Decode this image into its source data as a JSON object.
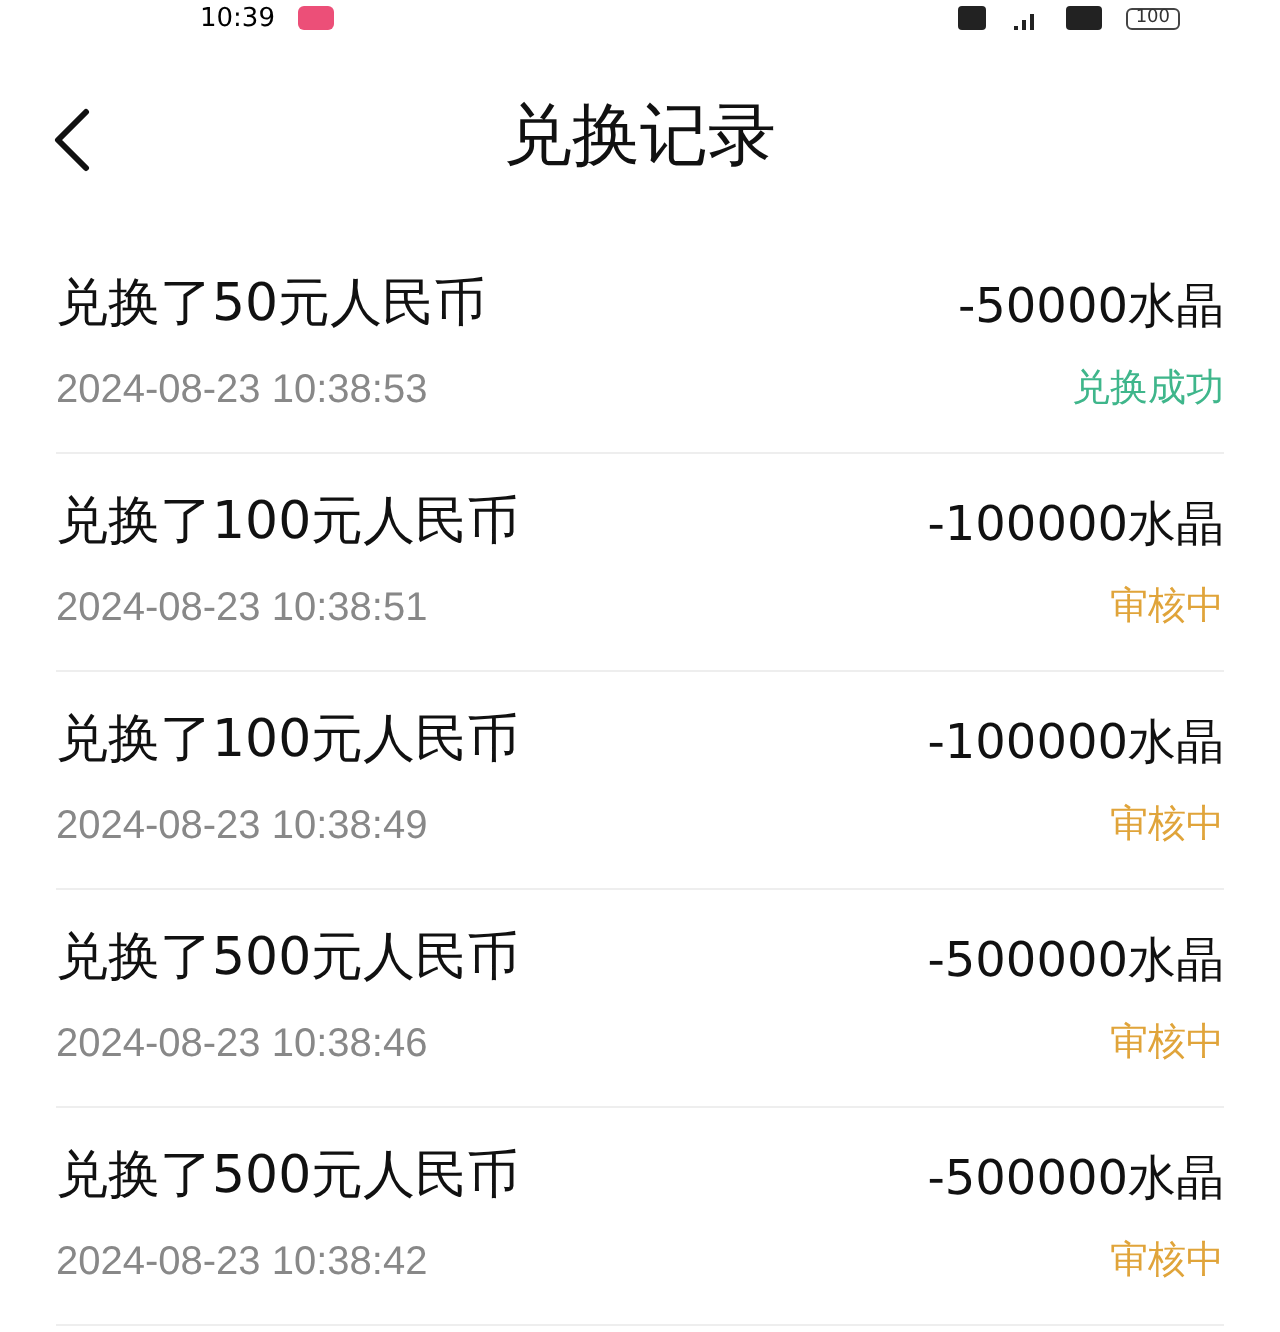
{
  "status_bar": {
    "time": "10:39",
    "battery": "100"
  },
  "header": {
    "title": "兑换记录"
  },
  "records": [
    {
      "title": "兑换了50元人民币",
      "amount": "-50000水晶",
      "time": "2024-08-23 10:38:53",
      "status": "兑换成功",
      "kind": "success"
    },
    {
      "title": "兑换了100元人民币",
      "amount": "-100000水晶",
      "time": "2024-08-23 10:38:51",
      "status": "审核中",
      "kind": "pending"
    },
    {
      "title": "兑换了100元人民币",
      "amount": "-100000水晶",
      "time": "2024-08-23 10:38:49",
      "status": "审核中",
      "kind": "pending"
    },
    {
      "title": "兑换了500元人民币",
      "amount": "-500000水晶",
      "time": "2024-08-23 10:38:46",
      "status": "审核中",
      "kind": "pending"
    },
    {
      "title": "兑换了500元人民币",
      "amount": "-500000水晶",
      "time": "2024-08-23 10:38:42",
      "status": "审核中",
      "kind": "pending"
    }
  ]
}
